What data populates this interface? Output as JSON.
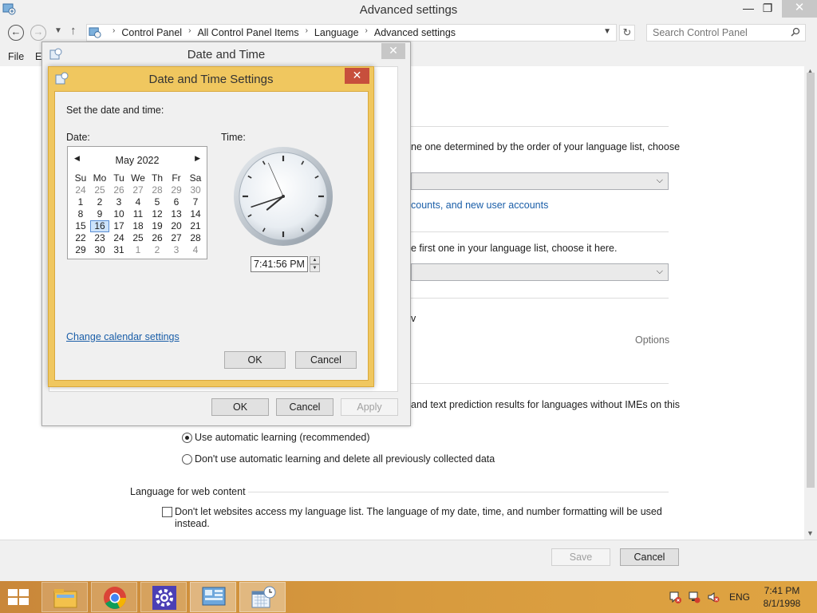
{
  "window": {
    "title": "Advanced settings",
    "controls": {
      "minimize": "—",
      "maximize": "❐",
      "close": "✕"
    }
  },
  "address": {
    "crumbs": [
      "Control Panel",
      "All Control Panel Items",
      "Language",
      "Advanced settings"
    ],
    "separator": "›",
    "search_placeholder": "Search Control Panel"
  },
  "menubar": {
    "items": [
      "File",
      "Ec"
    ]
  },
  "background": {
    "line1": "ne one determined by the order of your language list, choose",
    "link1": "counts, and new user accounts",
    "line2": "e first one in your language list, choose it here.",
    "line3": "v",
    "options": "Options",
    "line4": "and text prediction results for languages without IMEs on this",
    "radio_auto": "Use automatic learning (recommended)",
    "radio_noauto": "Don't use automatic learning and delete all previously collected data",
    "section_web": "Language for web content",
    "check_web_line1": "Don't let websites access my language list. The language of my date, time, and number formatting will be used",
    "check_web_line2": "instead."
  },
  "footer": {
    "save": "Save",
    "cancel": "Cancel"
  },
  "date_time_dialog": {
    "title": "Date and Time",
    "close": "✕",
    "ok": "OK",
    "cancel": "Cancel",
    "apply": "Apply"
  },
  "settings_dialog": {
    "title": "Date and Time Settings",
    "close": "✕",
    "instruction": "Set the date and time:",
    "date_label": "Date:",
    "time_label": "Time:",
    "calendar": {
      "month": "May 2022",
      "prev": "◀",
      "next": "▶",
      "weekdays": [
        "Su",
        "Mo",
        "Tu",
        "We",
        "Th",
        "Fr",
        "Sa"
      ],
      "weeks": [
        [
          "24",
          "25",
          "26",
          "27",
          "28",
          "29",
          "30"
        ],
        [
          "1",
          "2",
          "3",
          "4",
          "5",
          "6",
          "7"
        ],
        [
          "8",
          "9",
          "10",
          "11",
          "12",
          "13",
          "14"
        ],
        [
          "15",
          "16",
          "17",
          "18",
          "19",
          "20",
          "21"
        ],
        [
          "22",
          "23",
          "24",
          "25",
          "26",
          "27",
          "28"
        ],
        [
          "29",
          "30",
          "31",
          "1",
          "2",
          "3",
          "4"
        ]
      ],
      "selected": "16"
    },
    "time_value": "7:41:56 PM",
    "clock": {
      "hour": 7,
      "minute": 41,
      "second": 56
    },
    "change_calendar_link": "Change calendar settings",
    "ok": "OK",
    "cancel": "Cancel"
  },
  "taskbar": {
    "apps": [
      "file-explorer",
      "chrome",
      "settings",
      "control-panel",
      "date-time"
    ],
    "language": "ENG",
    "time": "7:41 PM",
    "date": "8/1/1998"
  },
  "colors": {
    "dialog_accent": "#f0c75f",
    "close_red": "#c74f3c",
    "taskbar": "#d79a3e",
    "link": "#1a5ea8"
  }
}
